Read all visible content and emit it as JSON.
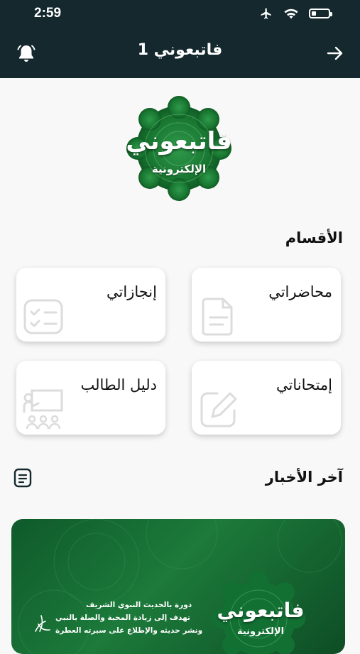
{
  "status_bar": {
    "time": "2:59"
  },
  "header": {
    "title": "فاتبعوني 1"
  },
  "logo": {
    "line1": "فاتبعوني",
    "line2": "الإلكترونية"
  },
  "sections": {
    "title": "الأقسام",
    "items": [
      {
        "label": "محاضراتي",
        "icon": "document-icon"
      },
      {
        "label": "إنجازاتي",
        "icon": "checklist-icon"
      },
      {
        "label": "إمتحاناتي",
        "icon": "edit-icon"
      },
      {
        "label": "دليل الطالب",
        "icon": "classroom-icon"
      }
    ]
  },
  "news": {
    "title": "آخر الأخبار",
    "banner": {
      "line1": "دورة بالحديث النبوي الشريف",
      "line2": "تهدف إلى زيادة المحبة والصلة بالنبي",
      "line3": "ونشر حديثه والإطلاع على سيرته العطرة",
      "logo_line1": "فاتبعوني",
      "logo_line2": "الإلكترونية"
    }
  },
  "colors": {
    "header_bg": "#14282e",
    "logo_green": "#1a7a35",
    "card_bg": "#ffffff",
    "icon_gray": "#dcdcdc"
  }
}
